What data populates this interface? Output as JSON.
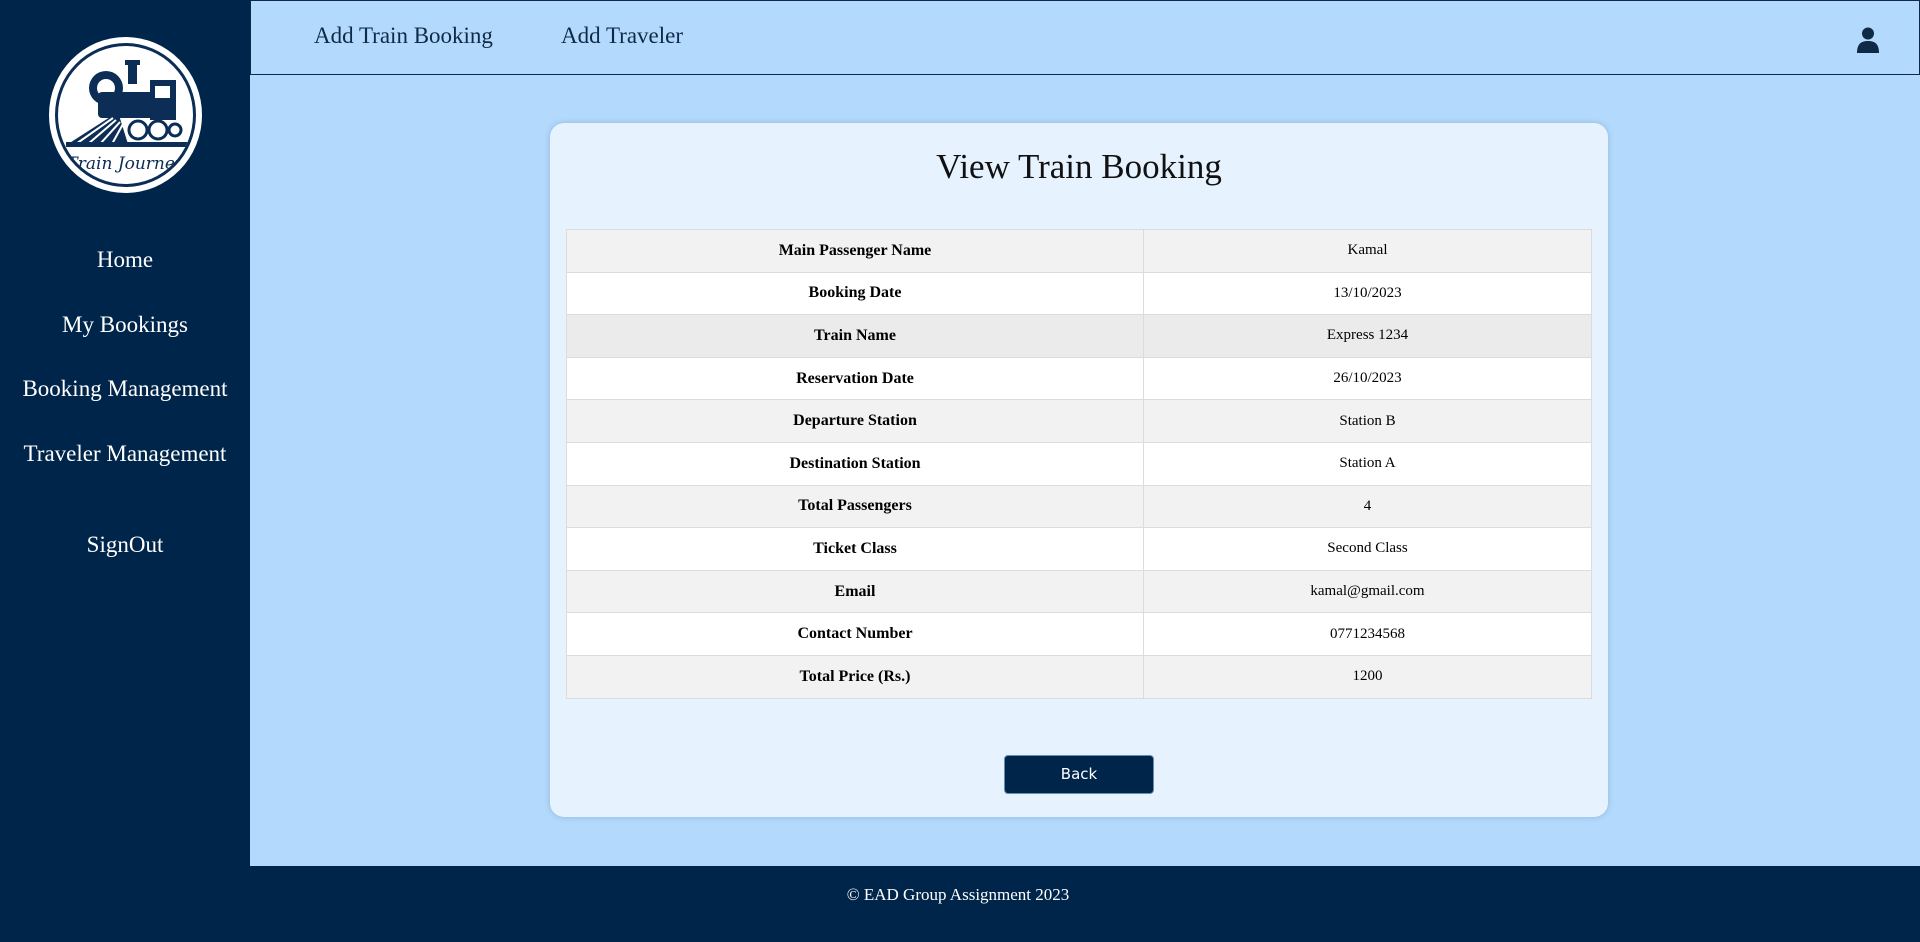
{
  "brand": {
    "logo_text": "Train Journey"
  },
  "sidebar": {
    "items": [
      {
        "label": "Home"
      },
      {
        "label": "My Bookings"
      },
      {
        "label": "Booking Management"
      },
      {
        "label": "Traveler Management"
      },
      {
        "label": "SignOut"
      }
    ]
  },
  "topbar": {
    "links": [
      {
        "label": "Add Train Booking"
      },
      {
        "label": "Add Traveler"
      }
    ],
    "user_icon": "user-icon"
  },
  "card": {
    "title": "View Train Booking",
    "rows": [
      {
        "key": "Main Passenger Name",
        "value": "Kamal"
      },
      {
        "key": "Booking Date",
        "value": "13/10/2023"
      },
      {
        "key": "Train Name",
        "value": "Express 1234"
      },
      {
        "key": "Reservation Date",
        "value": "26/10/2023"
      },
      {
        "key": "Departure Station",
        "value": "Station B"
      },
      {
        "key": "Destination Station",
        "value": "Station A"
      },
      {
        "key": "Total Passengers",
        "value": "4"
      },
      {
        "key": "Ticket Class",
        "value": "Second Class"
      },
      {
        "key": "Email",
        "value": "kamal@gmail.com"
      },
      {
        "key": "Contact Number",
        "value": "0771234568"
      },
      {
        "key": "Total Price (Rs.)",
        "value": "1200"
      }
    ],
    "back_label": "Back"
  },
  "footer": {
    "text": "© EAD Group Assignment 2023"
  },
  "colors": {
    "navy": "#00254a",
    "background": "#b3d9fc",
    "card": "#e6f2fe"
  }
}
